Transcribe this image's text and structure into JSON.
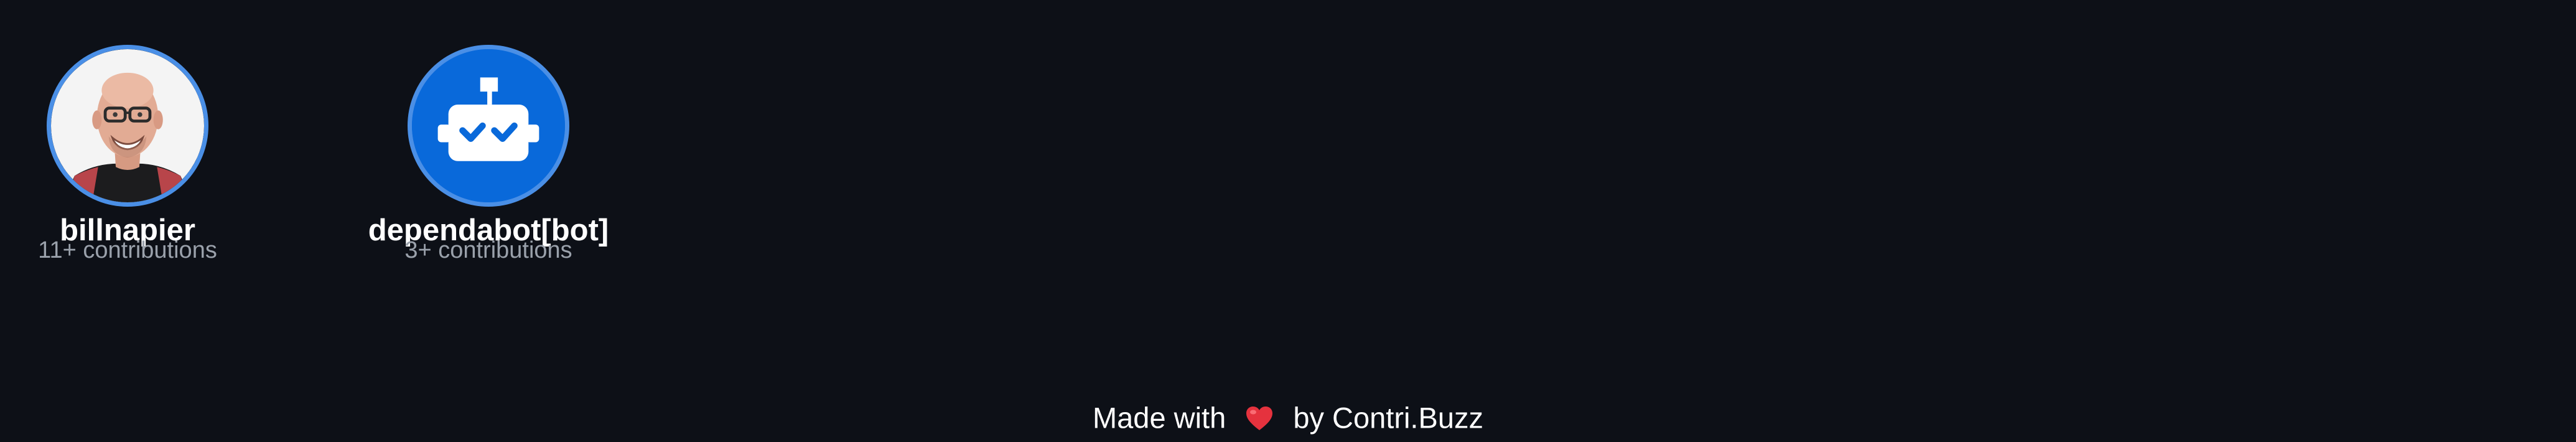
{
  "contributors": [
    {
      "name": "billnapier",
      "contributions": "11+ contributions",
      "avatar_icon": "person-photo-avatar",
      "ring_color": "#4a8fe6"
    },
    {
      "name": "dependabot[bot]",
      "contributions": "3+ contributions",
      "avatar_icon": "robot-icon",
      "ring_color": "#4a8fe6",
      "avatar_bg": "#0969da"
    }
  ],
  "footer": {
    "prefix": "Made with",
    "heart_icon": "heart-icon",
    "suffix": "by Contri.Buzz",
    "heart_color": "#e5323e"
  },
  "colors": {
    "background": "#0d1017",
    "muted_text": "#9aa1ab"
  }
}
